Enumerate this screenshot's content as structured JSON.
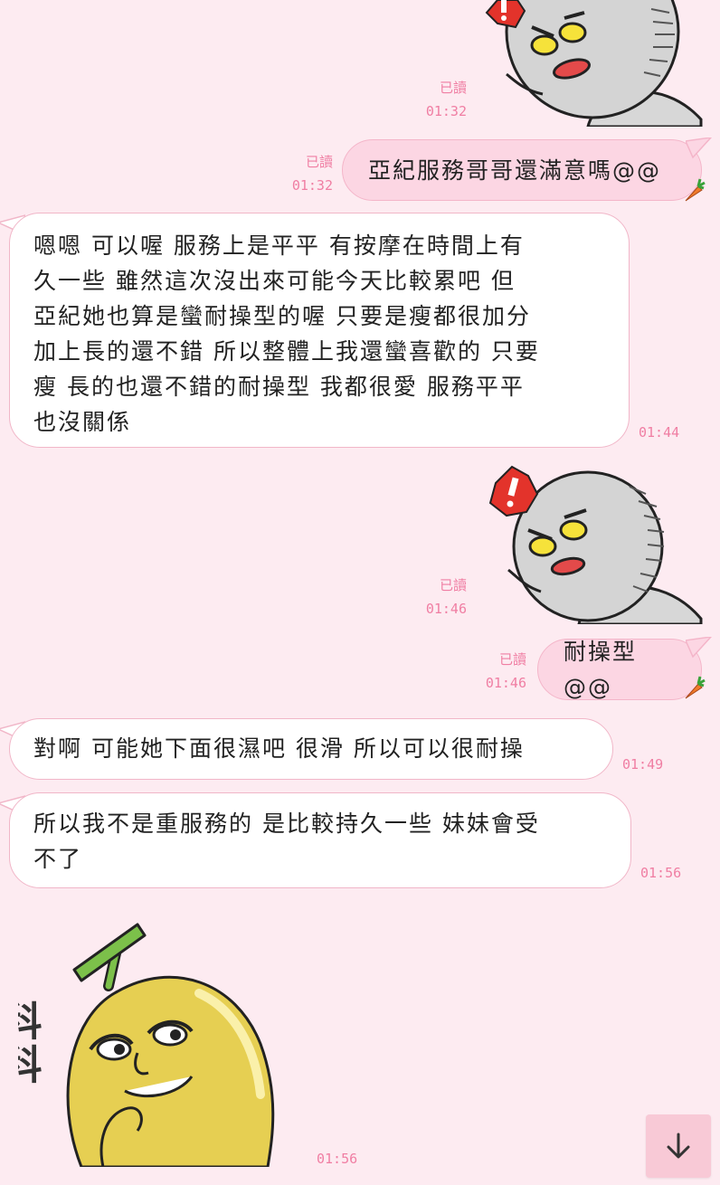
{
  "messages": [
    {
      "id": "m1",
      "side": "out",
      "type": "sticker",
      "read": "已讀",
      "time": "01:32"
    },
    {
      "id": "m2",
      "side": "out",
      "type": "text",
      "text": "亞紀服務哥哥還滿意嗎@@",
      "read": "已讀",
      "time": "01:32"
    },
    {
      "id": "m3",
      "side": "in",
      "type": "text",
      "lines": [
        "嗯嗯 可以喔 服務上是平平 有按摩在時間上有",
        "久一些  雖然這次沒出來可能今天比較累吧 但",
        "亞紀她也算是蠻耐操型的喔 只要是瘦都很加分",
        "加上長的還不錯 所以整體上我還蠻喜歡的 只要",
        "瘦 長的也還不錯的耐操型 我都很愛 服務平平",
        "也沒關係"
      ],
      "time": "01:44"
    },
    {
      "id": "m4",
      "side": "out",
      "type": "sticker",
      "read": "已讀",
      "time": "01:46"
    },
    {
      "id": "m5",
      "side": "out",
      "type": "text",
      "text": "耐操型@@",
      "read": "已讀",
      "time": "01:46"
    },
    {
      "id": "m6",
      "side": "in",
      "type": "text",
      "lines": [
        "對啊 可能她下面很濕吧 很滑 所以可以很耐操"
      ],
      "time": "01:49"
    },
    {
      "id": "m7",
      "side": "in",
      "type": "text",
      "lines": [
        "所以我不是重服務的 是比較持久一些 妹妹會受",
        "不了"
      ],
      "time": "01:56"
    },
    {
      "id": "m8",
      "side": "in",
      "type": "sticker",
      "sticker_text": "科科",
      "time": "01:56"
    }
  ],
  "icons": {
    "scroll_down": "arrow-down-icon",
    "decoration": "carrot-icon"
  },
  "colors": {
    "background": "#fdebf1",
    "bubble_out": "#fcd6e3",
    "bubble_in": "#ffffff",
    "meta": "#f07ea3"
  }
}
